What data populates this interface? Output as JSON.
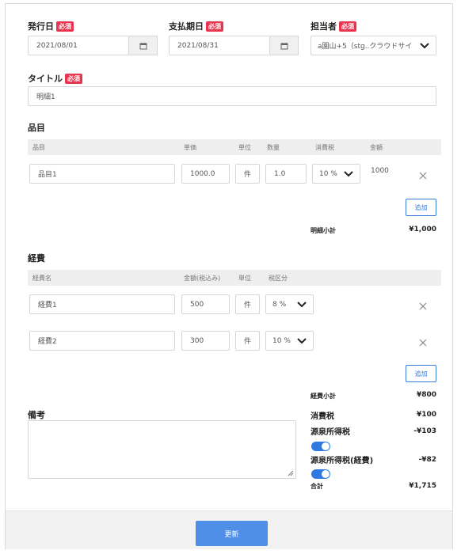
{
  "header": {
    "issue_date": {
      "label": "発行日",
      "required": "必須",
      "value": "2021/08/01"
    },
    "due_date": {
      "label": "支払期日",
      "required": "必須",
      "value": "2021/08/31"
    },
    "assignee": {
      "label": "担当者",
      "required": "必須",
      "value": "a園山+5（stg..クラウドサイ"
    }
  },
  "title_field": {
    "label": "タイトル",
    "required": "必須",
    "value": "明細1"
  },
  "items": {
    "section_title": "品目",
    "columns": [
      "品目",
      "単価",
      "単位",
      "数量",
      "消費税",
      "金額"
    ],
    "rows": [
      {
        "name": "品目1",
        "unit_price": "1000.0",
        "unit": "件",
        "quantity": "1.0",
        "tax": "10 %",
        "amount": "1000"
      }
    ],
    "add_label": "追加",
    "subtotal_label": "明細小計",
    "subtotal_value": "¥1,000"
  },
  "expenses": {
    "section_title": "経費",
    "columns": [
      "経費名",
      "金額(税込み)",
      "単位",
      "税区分"
    ],
    "rows": [
      {
        "name": "経費1",
        "amount": "500",
        "unit": "件",
        "tax": "8 %"
      },
      {
        "name": "経費2",
        "amount": "300",
        "unit": "件",
        "tax": "10 %"
      }
    ],
    "add_label": "追加",
    "subtotal_label": "経費小計",
    "subtotal_value": "¥800"
  },
  "notes": {
    "label": "備考",
    "value": ""
  },
  "summary": {
    "consumption_tax_label": "消費税",
    "consumption_tax_value": "¥100",
    "withholding_label": "源泉所得税",
    "withholding_value": "-¥103",
    "withholding_expense_label": "源泉所得税(経費)",
    "withholding_expense_value": "-¥82",
    "total_label": "合計",
    "total_value": "¥1,715"
  },
  "footer": {
    "update_label": "更新"
  },
  "colors": {
    "accent": "#2f7ae0",
    "required_badge": "#e8344e",
    "button": "#4f8fe8"
  }
}
